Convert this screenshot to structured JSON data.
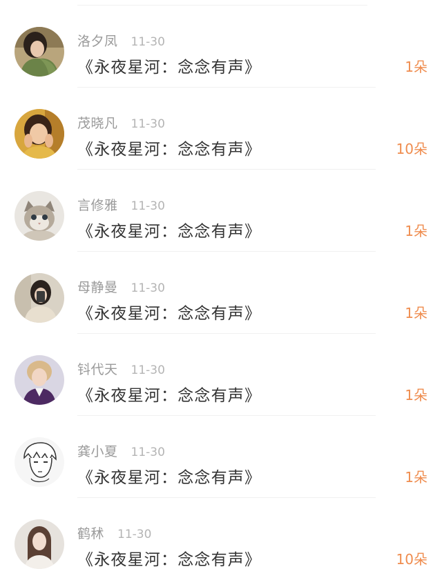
{
  "colors": {
    "name": "#9a9a9a",
    "time": "#b4b4b4",
    "title": "#333333",
    "count_accent": "#ef8c4e",
    "divider": "#f0f0f0"
  },
  "gift_list": [
    {
      "avatar_icon": "avatar-woman-green-dress",
      "name": "洛夕凤",
      "time": "11-30",
      "title": "《永夜星河：念念有声》",
      "count": "1朵"
    },
    {
      "avatar_icon": "avatar-woman-yellow-top",
      "name": "茂晓凡",
      "time": "11-30",
      "title": "《永夜星河：念念有声》",
      "count": "10朵"
    },
    {
      "avatar_icon": "avatar-kitten",
      "name": "言修雅",
      "time": "11-30",
      "title": "《永夜星河：念念有声》",
      "count": "1朵"
    },
    {
      "avatar_icon": "avatar-girl-selfie",
      "name": "母静曼",
      "time": "11-30",
      "title": "《永夜星河：念念有声》",
      "count": "1朵"
    },
    {
      "avatar_icon": "avatar-blond-man",
      "name": "钭代天",
      "time": "11-30",
      "title": "《永夜星河：念念有声》",
      "count": "1朵"
    },
    {
      "avatar_icon": "avatar-manga-sketch",
      "name": "龚小夏",
      "time": "11-30",
      "title": "《永夜星河：念念有声》",
      "count": "1朵"
    },
    {
      "avatar_icon": "avatar-woman-long-hair",
      "name": "鹤秫",
      "time": "11-30",
      "title": "《永夜星河：念念有声》",
      "count": "10朵"
    }
  ]
}
